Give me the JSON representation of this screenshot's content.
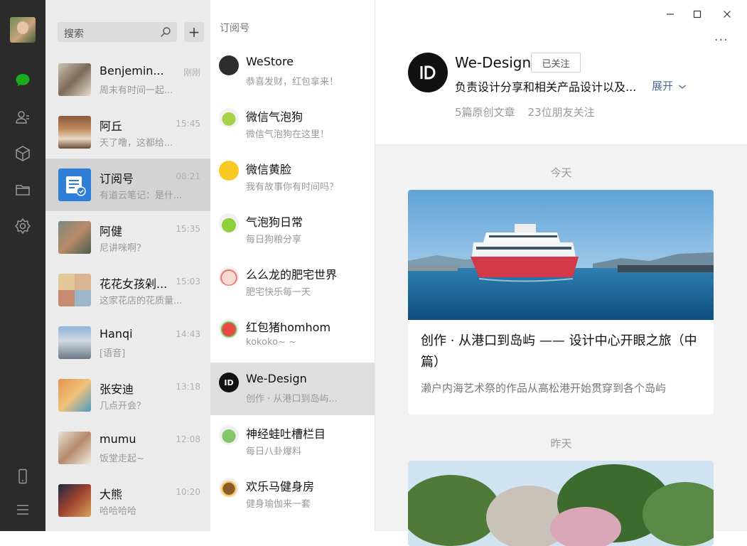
{
  "nav": {
    "items": [
      {
        "icon": "chat-icon",
        "active": true
      },
      {
        "icon": "contacts-icon"
      },
      {
        "icon": "box-icon"
      },
      {
        "icon": "folder-icon"
      },
      {
        "icon": "settings-icon"
      },
      {
        "icon": "phone-icon"
      },
      {
        "icon": "menu-icon"
      }
    ],
    "accent": "#1aad19"
  },
  "search": {
    "placeholder": "搜索",
    "add": "+"
  },
  "chats": [
    {
      "name": "Benjemin...",
      "time": "刚刚",
      "msg": "周末有时间一起..."
    },
    {
      "name": "阿丘",
      "time": "15:45",
      "msg": "天了噜，这都给..."
    },
    {
      "name": "订阅号",
      "time": "08:21",
      "msg": "有道云笔记：是什..."
    },
    {
      "name": "阿健",
      "time": "15:35",
      "msg": "尼讲咪啊？"
    },
    {
      "name": "花花女孩剁...",
      "time": "15:03",
      "msg": "这家花店的花质量..."
    },
    {
      "name": "Hanqi",
      "time": "14:43",
      "msg": "[语音]"
    },
    {
      "name": "张安迪",
      "time": "13:18",
      "msg": "几点开会？"
    },
    {
      "name": "mumu",
      "time": "12:08",
      "msg": "饭堂走起~"
    },
    {
      "name": "大熊",
      "time": "10:20",
      "msg": "哈哈哈哈"
    }
  ],
  "subscriptions": {
    "header": "订阅号",
    "items": [
      {
        "name": "WeStore",
        "msg": "恭喜发财，红包拿来！"
      },
      {
        "name": "微信气泡狗",
        "msg": "微信气泡狗在这里！"
      },
      {
        "name": "微信黄脸",
        "msg": "我有故事你有时间吗？"
      },
      {
        "name": "气泡狗日常",
        "msg": "每日狗粮分享"
      },
      {
        "name": "么么龙的肥宅世界",
        "msg": "肥宅快乐每一天"
      },
      {
        "name": "红包猪homhom",
        "msg": "kokoko~ ~"
      },
      {
        "name": "We-Design",
        "msg": "创作 · 从港口到岛屿..."
      },
      {
        "name": "神经蛙吐槽栏目",
        "msg": "每日八卦爆料"
      },
      {
        "name": "欢乐马健身房",
        "msg": "健身瑜伽来一套"
      }
    ]
  },
  "profile": {
    "name": "We-Design",
    "follow_label": "已关注",
    "desc": "负责设计分享和相关产品设计以及...",
    "expand": "展开",
    "stat_articles": "5篇原创文章",
    "stat_friends": "23位朋友关注",
    "more": "···"
  },
  "feed": {
    "today": "今天",
    "yesterday": "昨天",
    "article": {
      "title": "创作 · 从港口到岛屿 —— 设计中心开眼之旅（中篇）",
      "desc": "濑户内海艺术祭的作品从高松港开始贯穿到各个岛屿"
    }
  }
}
